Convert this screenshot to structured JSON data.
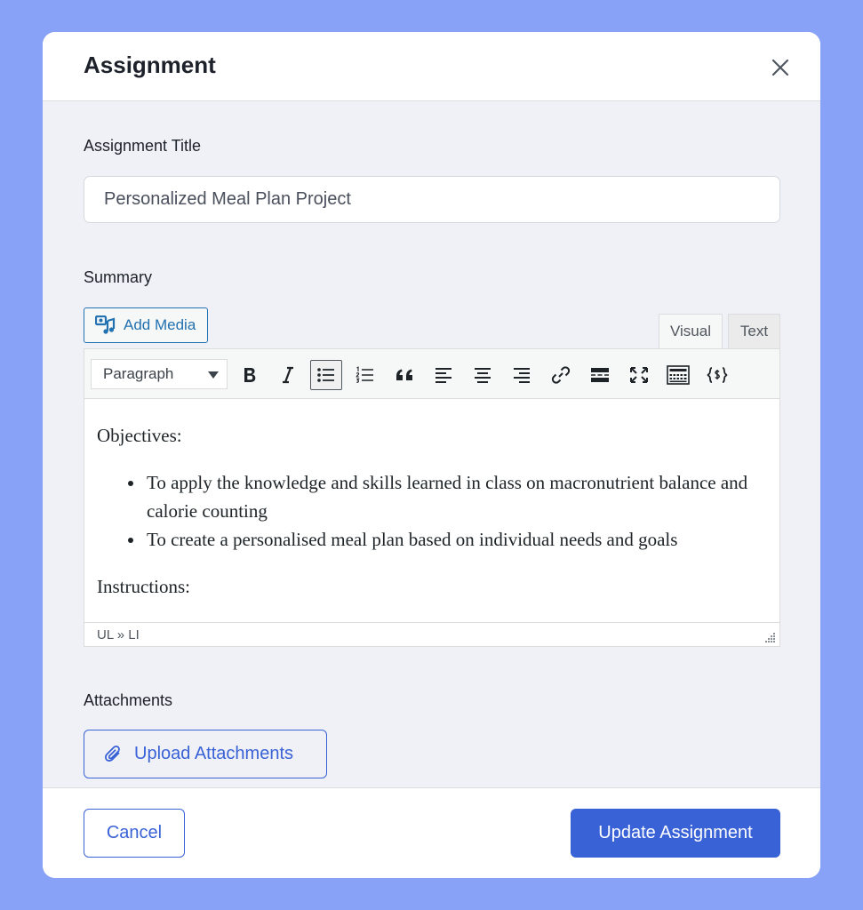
{
  "modal": {
    "title": "Assignment"
  },
  "form": {
    "title_label": "Assignment Title",
    "title_value": "Personalized Meal Plan Project",
    "summary_label": "Summary",
    "attachments_label": "Attachments"
  },
  "editor": {
    "add_media_label": "Add Media",
    "tabs": [
      {
        "label": "Visual",
        "active": true
      },
      {
        "label": "Text",
        "active": false
      }
    ],
    "format_value": "Paragraph",
    "toolbar_icons": [
      "bold-icon",
      "italic-icon",
      "bullet-list-icon",
      "numbered-list-icon",
      "blockquote-icon",
      "align-left-icon",
      "align-center-icon",
      "align-right-icon",
      "link-icon",
      "read-more-icon",
      "fullscreen-icon",
      "toolbar-toggle-icon",
      "shortcode-icon"
    ],
    "content": {
      "heading1": "Objectives:",
      "bullets": [
        "To apply the knowledge and skills learned in class on macronutrient balance and calorie counting",
        "To create a personalised meal plan based on individual needs and goals"
      ],
      "heading2": "Instructions:"
    },
    "status_path": "UL » LI"
  },
  "buttons": {
    "upload_label": "Upload Attachments",
    "cancel_label": "Cancel",
    "update_label": "Update Assignment"
  },
  "colors": {
    "background": "#87a2f6",
    "primary": "#3a62d7",
    "wp_link": "#2271b1"
  }
}
